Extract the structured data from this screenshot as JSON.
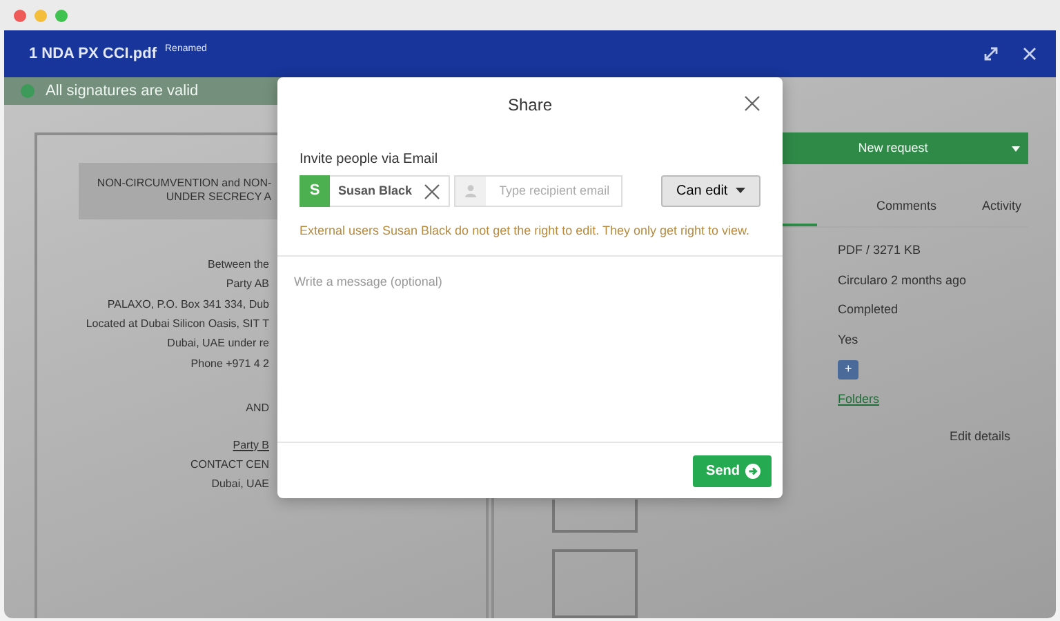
{
  "app": {
    "file_name": "1 NDA PX CCI.pdf",
    "file_badge": "Renamed"
  },
  "status_bar": {
    "text": "All signatures are valid"
  },
  "document": {
    "title_lines": [
      "NON-CIRCUMVENTION and NON-",
      "UNDER SECRECY A"
    ],
    "lines": [
      {
        "text": "Between the",
        "kind": "plain"
      },
      {
        "text": "Party AB",
        "kind": "plain"
      },
      {
        "text": "PALAXO, P.O. Box 341 334, Dub",
        "kind": "plain"
      },
      {
        "text": "Located at Dubai Silicon Oasis, SIT T",
        "kind": "plain"
      },
      {
        "text": "Dubai, UAE under re",
        "kind": "plain"
      },
      {
        "text": "Phone  +971 4 2",
        "kind": "plain"
      },
      {
        "text": "AND",
        "kind": "gap"
      },
      {
        "text": "Party B",
        "kind": "underlined"
      },
      {
        "text": "CONTACT CEN",
        "kind": "plain"
      },
      {
        "text": "Dubai, UAE",
        "kind": "plain"
      }
    ]
  },
  "side_panel": {
    "primary_button": "New request",
    "tabs": [
      {
        "label": "Comments"
      },
      {
        "label": "Activity"
      }
    ],
    "values": [
      {
        "text": "PDF  /  3271 KB",
        "kind": "text"
      },
      {
        "text": "Circularo 2 months ago",
        "kind": "text"
      },
      {
        "text": "Completed",
        "kind": "text"
      },
      {
        "text": "Yes",
        "kind": "text"
      },
      {
        "text": "+",
        "kind": "chip"
      },
      {
        "text": "Folders",
        "kind": "link"
      }
    ],
    "edit_button": "Edit details"
  },
  "share_dialog": {
    "title": "Share",
    "invite_label": "Invite people via Email",
    "recipients": [
      {
        "initial": "S",
        "name": "Susan Black",
        "color": "#4caf50"
      }
    ],
    "email_placeholder": "Type recipient email",
    "permission": "Can edit",
    "warning": "External users Susan Black do not get the right to edit. They only get right to view.",
    "message_placeholder": "Write a message (optional)",
    "send_button": "Send"
  }
}
